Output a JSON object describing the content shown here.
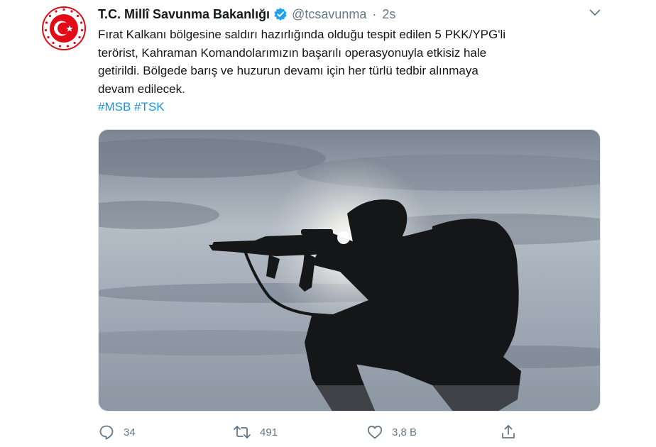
{
  "tweet": {
    "author": {
      "display_name": "T.C. Millî Savunma Bakanlığı",
      "handle": "@tcsavunma",
      "verified": true,
      "avatar_icon": "ministry-emblem-icon"
    },
    "separator": "·",
    "timestamp": "2s",
    "text_lines": [
      "Fırat Kalkanı bölgesine saldırı hazırlığında olduğu tespit edilen 5 PKK/YPG'li",
      "terörist, Kahraman Komandolarımızın başarılı operasyonuyla etkisiz hale",
      "getirildi. Bölgede barış ve huzurun devamı için her türlü tedbir alınmaya",
      "devam edilecek."
    ],
    "hashtags": [
      "#MSB",
      "#TSK"
    ],
    "media": {
      "icon": "soldier-silhouette-photo"
    },
    "actions": {
      "reply_count": "34",
      "retweet_count": "491",
      "like_count": "3,8 B"
    },
    "colors": {
      "link": "#1b95e0",
      "secondary_text": "#657786",
      "verified_badge": "#1da1f2",
      "emblem_red": "#e30a17"
    }
  }
}
